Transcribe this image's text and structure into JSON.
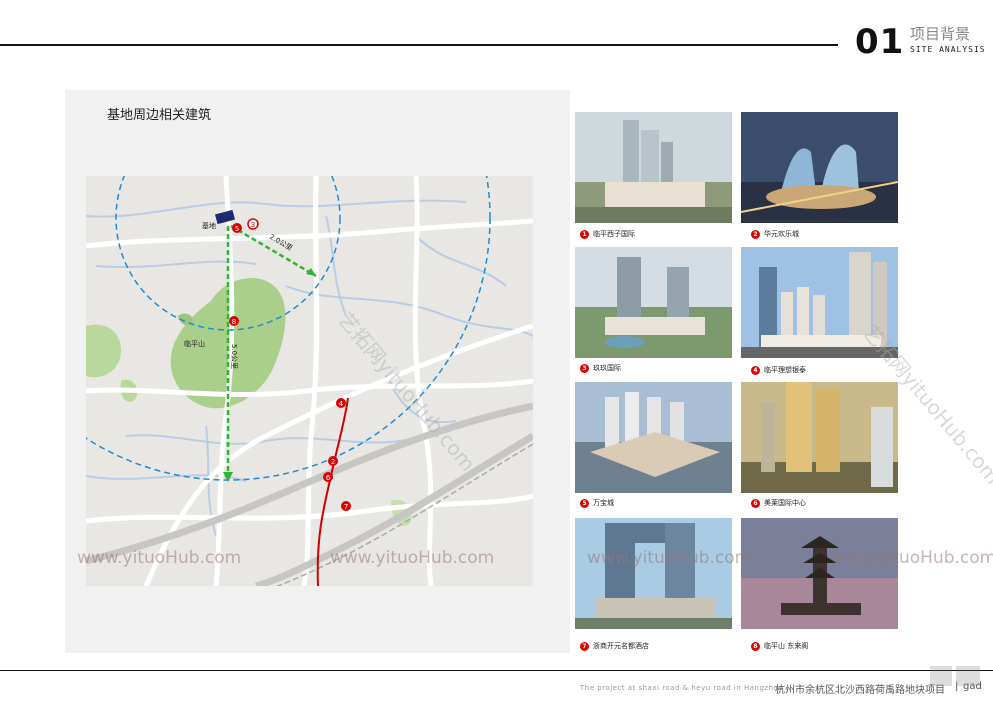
{
  "header": {
    "section_number": "01",
    "section_cn": "项目背景",
    "section_en": "SITE ANALYSIS"
  },
  "map": {
    "title": "基地周边相关建筑",
    "site_label": "基地",
    "mountain_label": "临平山",
    "distance_label_1": "2.0公里",
    "distance_label_2": "5.0公里"
  },
  "photos": [
    {
      "num": "1",
      "caption": "临平西子国际"
    },
    {
      "num": "2",
      "caption": "华元欢乐城"
    },
    {
      "num": "3",
      "caption": "玖玖国际"
    },
    {
      "num": "4",
      "caption": "临平理想银泰"
    },
    {
      "num": "5",
      "caption": "万宝城"
    },
    {
      "num": "6",
      "caption": "美莱国际中心"
    },
    {
      "num": "7",
      "caption": "浙商开元名都酒店"
    },
    {
      "num": "8",
      "caption": "临平山 东来阁"
    }
  ],
  "map_markers": [
    "5",
    "3",
    "8",
    "4",
    "2",
    "6",
    "7"
  ],
  "footer": {
    "en": "The project at shaxi road & heyu road in Hangzhou",
    "cn": "杭州市余杭区北沙西路荷禹路地块项目",
    "sep": "|",
    "brand": "gad"
  },
  "watermark": {
    "text": "www.yituoHub.com",
    "rot_text": "艺拓网yituoHub.com"
  },
  "colors": {
    "accent_red": "#e10000",
    "ring_blue": "#1f8ad8",
    "route_green": "#2fb52f",
    "park_green": "#a9cf8a"
  }
}
